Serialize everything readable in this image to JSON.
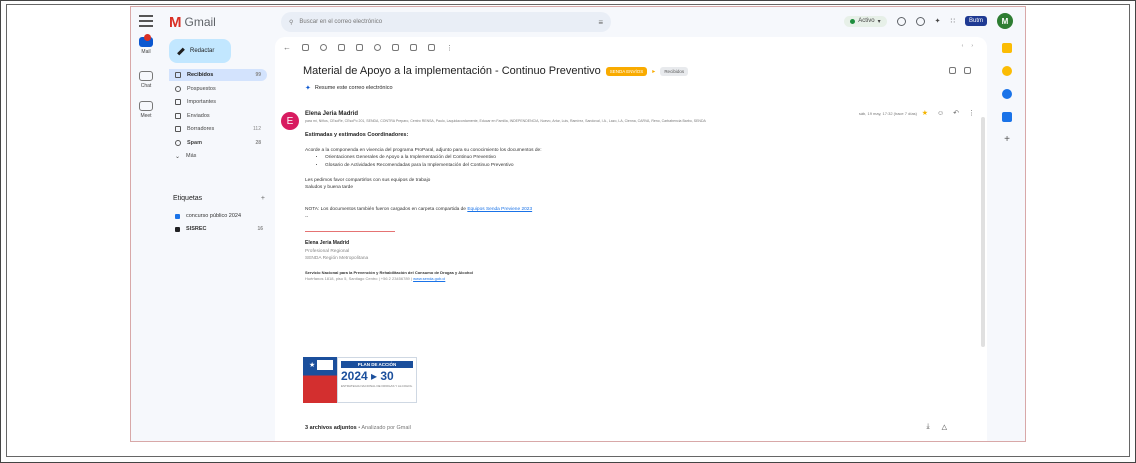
{
  "app": {
    "name": "Gmail",
    "logo_letter": "M"
  },
  "search": {
    "placeholder": "Buscar en el correo electrónico"
  },
  "topbar": {
    "status": "Activo",
    "brand": "Butm",
    "avatar_letter": "M"
  },
  "rail": [
    {
      "label": "Mail",
      "color": "#0b57d0"
    },
    {
      "label": "Chat",
      "color": "#9aa0a6"
    },
    {
      "label": "Meet",
      "color": "#9aa0a6"
    }
  ],
  "sidebar": {
    "compose_label": "Redactar",
    "items": [
      {
        "label": "Recibidos",
        "count": "99",
        "active": true
      },
      {
        "label": "Pospuestos",
        "count": ""
      },
      {
        "label": "Importantes",
        "count": ""
      },
      {
        "label": "Enviados",
        "count": ""
      },
      {
        "label": "Borradores",
        "count": "112"
      },
      {
        "label": "Spam",
        "count": "28"
      },
      {
        "label": "Más",
        "count": ""
      }
    ],
    "labels_header": "Etiquetas",
    "labels": [
      {
        "label": "concurso público 2024",
        "color": "#1a73e8",
        "count": ""
      },
      {
        "label": "SISREC",
        "color": "#202124",
        "count": "16"
      }
    ]
  },
  "message": {
    "subject": "Material de Apoyo a la implementación - Continuo Preventivo",
    "tag_primary": "SENDA ENVÍOS",
    "tag_secondary": "Recibidos",
    "summary_label": "Resume este correo electrónico",
    "sender": "Elena Jeria Madrid",
    "avatar_letter": "E",
    "recipients": "para mí, Niños, CEsoRe, CEsoPo 201, SENDA, CONTRA Preparo, Centro RENSA, Paulo, Laquidacordamente, Educar en Familia, INDEPENDENCIA, Nuevo, Artur, Luis, Ramírez, Sandoval, I.A., Lazo, LA, Cienna, CARVA, Reno, Carbabencia Barbo, SENDA",
    "date": "sáb, 19 may, 17:32 (hace 7 días)",
    "greeting": "Estimadas y estimados Coordinadores:",
    "intro": "Acorde a la componenda en vivencia del programa ProParal, adjunto para su conocimiento los documentos de:",
    "bullets": [
      "Orientaciones Generales de Apoyo a la Implementación del Continuo Preventivo",
      "Glosario de Actividades Recomendadas para la Implementación del Continuo Preventivo"
    ],
    "line1": "Les pedimos favor compartirlos con sus equipos de trabajo",
    "line2": "Saludos y buena tarde",
    "nota": "NOTA: Los documentos también fueron cargados en carpeta compartida de",
    "nota_link": "Equipos Senda Previene 2023",
    "dashes": "--",
    "sig_name": "Elena Jeria Madrid",
    "sig_role1": "Profesional Regional",
    "sig_role2": "SENDA Región Metropolitana",
    "sig_org": "Servicio Nacional para la Prevención y Rehabilitación del Consumo de Drogas y Alcohol",
    "sig_addr": "Huérfanos 1818, piso 5, Santiago Centro | +56 2 23456789 |",
    "sig_link": "www.senda.gob.cl",
    "plan_title": "PLAN DE ACCIÓN",
    "plan_year": "2024 ▸ 30",
    "plan_sub": "ESTRATEGIA NACIONAL DE DROGAS Y ALCOHOL",
    "attachments_count": "3 archivos adjuntos",
    "attachments_note": "• Analizado por Gmail"
  },
  "colors": {
    "accent": "#0b57d0",
    "compose": "#c2e7ff",
    "tag": "#f9ab00",
    "avatar": "#d81b60"
  }
}
